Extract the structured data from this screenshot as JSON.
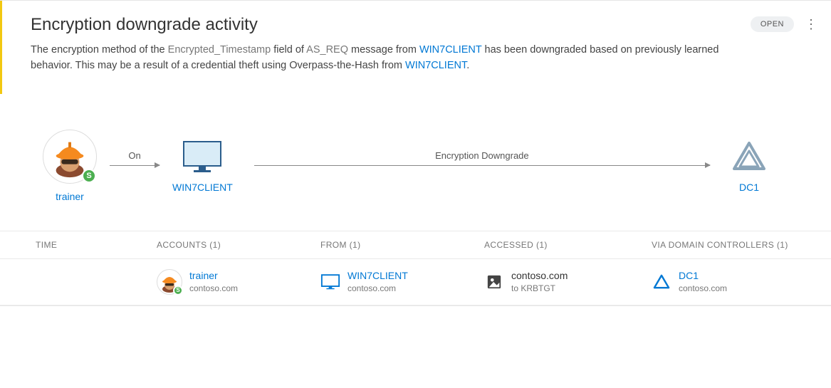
{
  "alert": {
    "title": "Encryption downgrade activity",
    "status": "OPEN",
    "description": {
      "pre1": "The encryption method of the ",
      "field": "Encrypted_Timestamp",
      "mid1": " field of ",
      "msg": "AS_REQ",
      "mid2": " message from ",
      "client1": "WIN7CLIENT",
      "mid3": " has been downgraded based on previously learned behavior. This may be a result of a credential theft using Overpass-the-Hash from ",
      "client2": "WIN7CLIENT",
      "end": "."
    }
  },
  "diagram": {
    "on_label": "On",
    "main_label": "Encryption Downgrade",
    "user": {
      "name": "trainer"
    },
    "source": {
      "name": "WIN7CLIENT"
    },
    "target": {
      "name": "DC1"
    }
  },
  "table": {
    "headers": {
      "time": "TIME",
      "accounts": "ACCOUNTS (1)",
      "from": "FROM (1)",
      "accessed": "ACCESSED (1)",
      "dc": "VIA DOMAIN CONTROLLERS (1)"
    },
    "row": {
      "account": {
        "name": "trainer",
        "domain": "contoso.com"
      },
      "from": {
        "name": "WIN7CLIENT",
        "domain": "contoso.com"
      },
      "accessed": {
        "target": "contoso.com",
        "sub": "to KRBTGT"
      },
      "dc": {
        "name": "DC1",
        "domain": "contoso.com"
      }
    }
  }
}
